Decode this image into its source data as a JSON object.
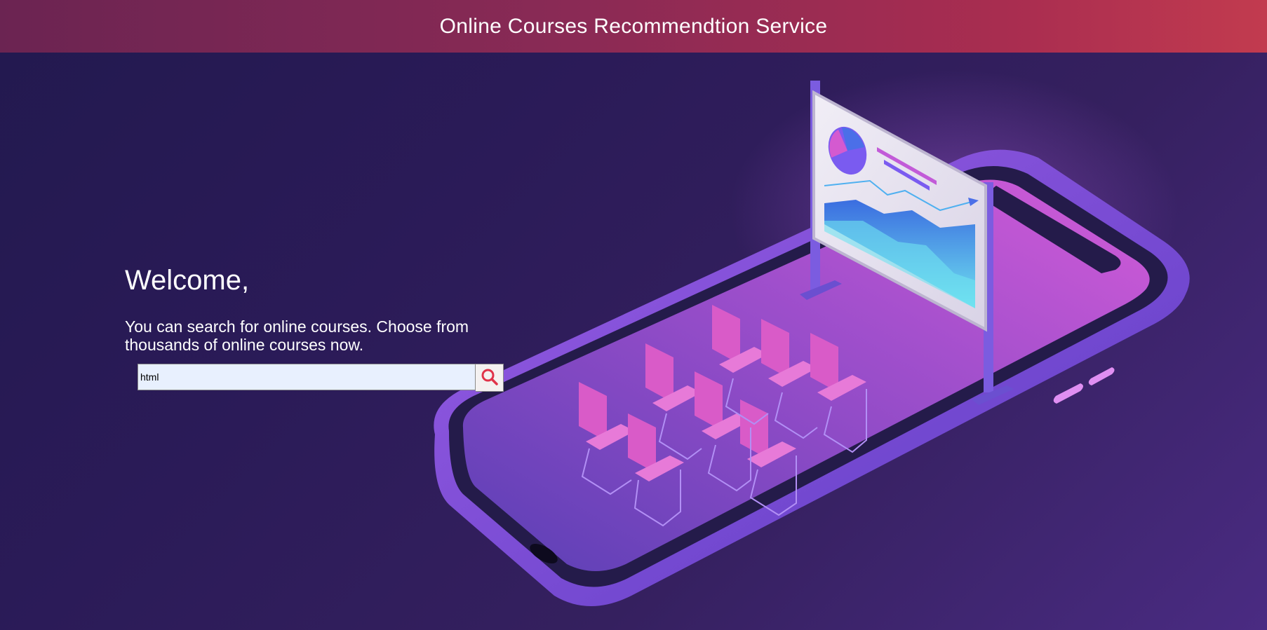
{
  "header": {
    "title": "Online Courses Recommendtion Service"
  },
  "main": {
    "heading": "Welcome,",
    "description": "You can search for online courses. Choose from thousands of online courses now."
  },
  "search": {
    "value": "html",
    "button_icon": "search-icon"
  },
  "colors": {
    "header_start": "#6b2452",
    "header_end": "#c23b4f",
    "background": "#2b1b58",
    "search_icon": "#e0334a",
    "input_background": "#e8f0fe"
  },
  "illustration": {
    "icon": "phone-classroom-illustration"
  }
}
